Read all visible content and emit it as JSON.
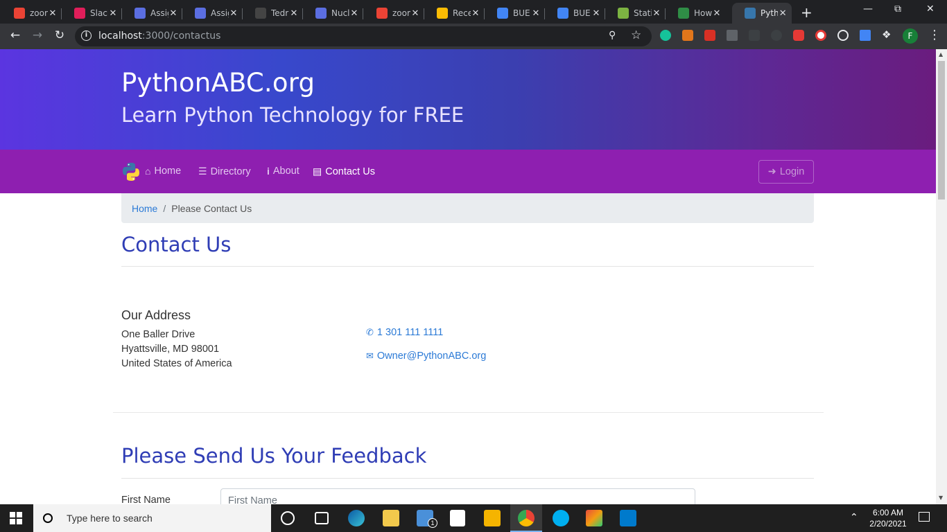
{
  "browser": {
    "tabs": [
      {
        "title": "zoom",
        "icon": "gmail-icon",
        "color": "#ea4335"
      },
      {
        "title": "Slack",
        "icon": "slack-icon",
        "color": "#e01e5a"
      },
      {
        "title": "Assig",
        "icon": "assignment-icon",
        "color": "#5b6ee1"
      },
      {
        "title": "Assig",
        "icon": "assignment-icon",
        "color": "#5b6ee1"
      },
      {
        "title": "Tedr",
        "icon": "github-icon",
        "color": "#444"
      },
      {
        "title": "Nucl",
        "icon": "assignment-icon",
        "color": "#5b6ee1"
      },
      {
        "title": "zoom",
        "icon": "gmail-icon",
        "color": "#ea4335"
      },
      {
        "title": "Rece",
        "icon": "google-drive-icon",
        "color": "#fbbc04"
      },
      {
        "title": "BUE",
        "icon": "google-docs-icon",
        "color": "#4285f4"
      },
      {
        "title": "BUE",
        "icon": "google-docs-icon",
        "color": "#4285f4"
      },
      {
        "title": "Stati",
        "icon": "cactus-icon",
        "color": "#7cb342"
      },
      {
        "title": "How",
        "icon": "geeksforgeeks-icon",
        "color": "#2f8d46"
      },
      {
        "title": "Pyth",
        "icon": "python-icon",
        "color": "#3776ab",
        "active": true
      }
    ],
    "url_host": "localhost",
    "url_path": ":3000/contactus",
    "profile_initial": "F"
  },
  "site": {
    "title": "PythonABC.org",
    "subtitle": "Learn Python Technology for FREE",
    "nav": {
      "home": "Home",
      "directory": "Directory",
      "about": "About",
      "contact": "Contact Us",
      "login": "Login"
    },
    "breadcrumb": {
      "home": "Home",
      "current": "Please Contact Us"
    },
    "contact_heading": "Contact Us",
    "address": {
      "title": "Our Address",
      "line1": "One Baller Drive",
      "line2": "Hyattsville, MD 98001",
      "line3": "United States of America"
    },
    "phone": "1 301 111 1111",
    "email": "Owner@PythonABC.org",
    "feedback_heading": "Please Send Us Your Feedback",
    "form": {
      "first_name_label": "First Name",
      "first_name_placeholder": "First Name"
    }
  },
  "taskbar": {
    "search_placeholder": "Type here to search",
    "time": "6:00 AM",
    "date": "2/20/2021",
    "mail_badge": "1"
  },
  "colors": {
    "hero_start": "#5b35e0",
    "hero_end": "#6a1c7e",
    "nav_bg": "#8e1fb0",
    "heading": "#2f3db5",
    "link": "#2b7ad6"
  }
}
